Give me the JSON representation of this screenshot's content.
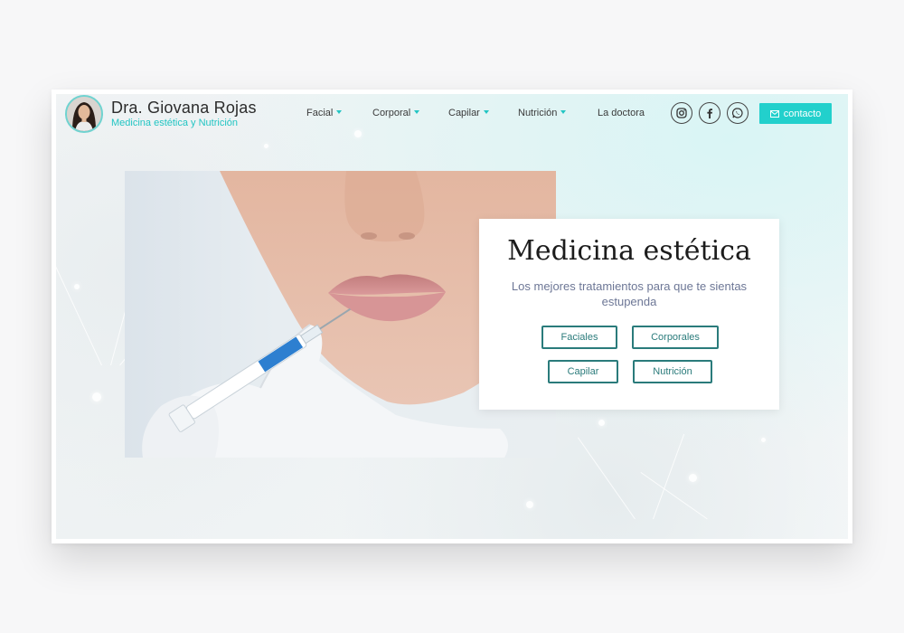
{
  "brand": {
    "name": "Dra. Giovana Rojas",
    "subtitle": "Medicina estética y Nutrición"
  },
  "nav": {
    "items": [
      {
        "label": "Facial",
        "has_dropdown": true
      },
      {
        "label": "Corporal",
        "has_dropdown": true
      },
      {
        "label": "Capilar",
        "has_dropdown": true
      },
      {
        "label": "Nutrición",
        "has_dropdown": true
      },
      {
        "label": "La doctora",
        "has_dropdown": false
      }
    ]
  },
  "social": {
    "icons": [
      "instagram-icon",
      "facebook-icon",
      "whatsapp-icon"
    ]
  },
  "contact": {
    "label": "contacto",
    "icon": "mail-icon"
  },
  "hero": {
    "title": "Medicina estética",
    "subtitle": "Los mejores tratamientos para que te sientas estupenda",
    "buttons": [
      "Faciales",
      "Corporales",
      "Capilar",
      "Nutrición"
    ]
  },
  "colors": {
    "accent": "#22d0cc",
    "button_border": "#2a7b7b",
    "subtitle_text": "#6d7796"
  }
}
